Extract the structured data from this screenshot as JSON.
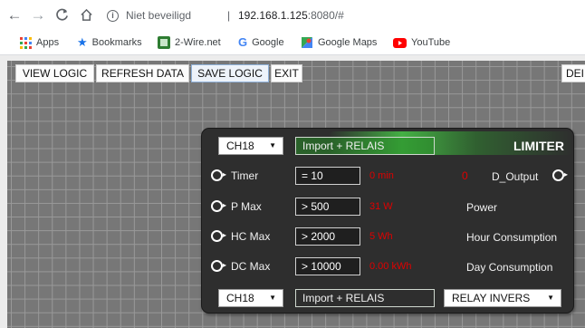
{
  "browser": {
    "security_label": "Niet beveiligd",
    "separator": "|",
    "url_host": "192.168.1.125",
    "url_rest": ":8080/#"
  },
  "bookmarks": {
    "apps": "Apps",
    "bookmarks": "Bookmarks",
    "two_wire": "2-Wire.net",
    "google": "Google",
    "google_maps": "Google Maps",
    "youtube": "YouTube"
  },
  "menu": {
    "view_logic": "VIEW LOGIC",
    "refresh_data": "REFRESH DATA",
    "save_logic": "SAVE LOGIC",
    "exit": "EXIT",
    "delete_partial": "DEI"
  },
  "node": {
    "title": "LIMITER",
    "top_channel": "CH18",
    "top_source": "Import + RELAIS",
    "bottom_channel": "CH18",
    "bottom_source": "Import + RELAIS",
    "relay_mode": "RELAY INVERS",
    "rows": [
      {
        "label": "Timer",
        "input": "= 10",
        "readout": "0 min",
        "out_value": "0",
        "out_label": "D_Output"
      },
      {
        "label": "P Max",
        "input": "> 500",
        "readout": "31 W",
        "out_label": "Power"
      },
      {
        "label": "HC Max",
        "input": "> 2000",
        "readout": "5 Wh",
        "out_label": "Hour Consumption"
      },
      {
        "label": "DC Max",
        "input": "> 10000",
        "readout": "0.00 kWh",
        "out_label": "Day Consumption"
      }
    ]
  },
  "colors": {
    "accent_green": "#46be46",
    "readout_red": "#e00000",
    "node_bg": "#2e2e2e",
    "grid_bg": "#777777"
  }
}
